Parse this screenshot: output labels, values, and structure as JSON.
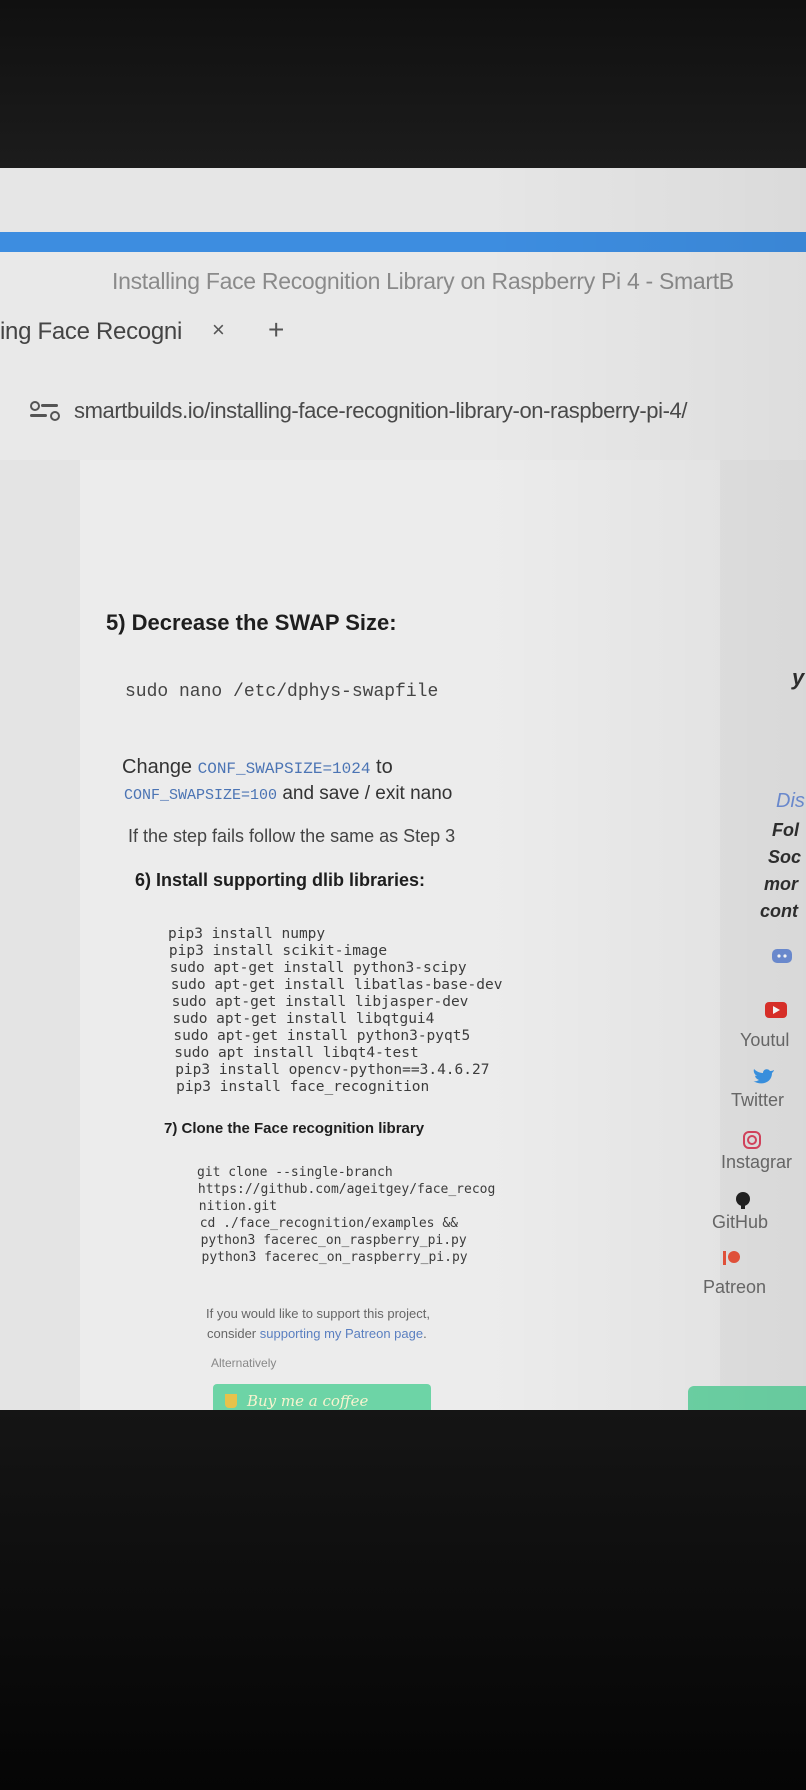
{
  "window": {
    "title": "Installing Face Recognition Library on Raspberry Pi 4 - SmartB"
  },
  "tab": {
    "title": "ing Face Recogni",
    "close_symbol": "×",
    "new_tab_symbol": "+"
  },
  "address_bar": {
    "url": "smartbuilds.io/installing-face-recognition-library-on-raspberry-pi-4/"
  },
  "article": {
    "step5": {
      "heading": "5) Decrease the SWAP Size:",
      "command": "sudo nano /etc/dphys-swapfile",
      "change_text_prefix": "Change",
      "code_from": "CONF_SWAPSIZE=1024",
      "to_word": "to",
      "code_to": "CONF_SWAPSIZE=100",
      "change_text_suffix": "and save / exit nano",
      "note": "If the step fails follow the same as Step 3"
    },
    "step6": {
      "heading": "6) Install supporting dlib libraries:",
      "lines": [
        "pip3 install numpy",
        "pip3 install scikit-image",
        "sudo apt-get install python3-scipy",
        "sudo apt-get install libatlas-base-dev",
        "sudo apt-get install libjasper-dev",
        "sudo apt-get install libqtgui4",
        "sudo apt-get install python3-pyqt5",
        "sudo apt install libqt4-test",
        "pip3 install opencv-python==3.4.6.27",
        "pip3 install face_recognition"
      ]
    },
    "step7": {
      "heading": "7) Clone the Face recognition library",
      "lines": [
        "git clone --single-branch",
        "https://github.com/ageitgey/face_recog",
        "nition.git",
        "cd ./face_recognition/examples &&",
        "python3 facerec_on_raspberry_pi.py",
        "python3 facerec_on_raspberry_pi.py"
      ]
    },
    "support": {
      "line1": "If you would like to support this project,",
      "line2_prefix": "consider ",
      "line2_link": "supporting my Patreon page",
      "line2_suffix": ".",
      "alternatively": "Alternatively",
      "coffee_label": "Buy me a coffee"
    }
  },
  "sidebar": {
    "partial_y": "y",
    "partial_dis": "Dis",
    "partial_lines": [
      "Fol",
      "Soc",
      "mor",
      "cont"
    ],
    "social": [
      {
        "label": "Youtul",
        "icon": "youtube-icon",
        "color": "#e0302a"
      },
      {
        "label": "Twitter",
        "icon": "twitter-icon",
        "color": "#3a95e6"
      },
      {
        "label": "Instagrar",
        "icon": "instagram-icon",
        "color": "#d9455f"
      },
      {
        "label": "GitHub",
        "icon": "github-icon",
        "color": "#222222"
      },
      {
        "label": "Patreon",
        "icon": "patreon-icon",
        "color": "#e8533b"
      }
    ],
    "discord_icon": "discord-icon"
  },
  "colors": {
    "accent": "#3d8de0",
    "code_inline": "#4b74b4",
    "coffee_button": "#6dd4a6"
  }
}
